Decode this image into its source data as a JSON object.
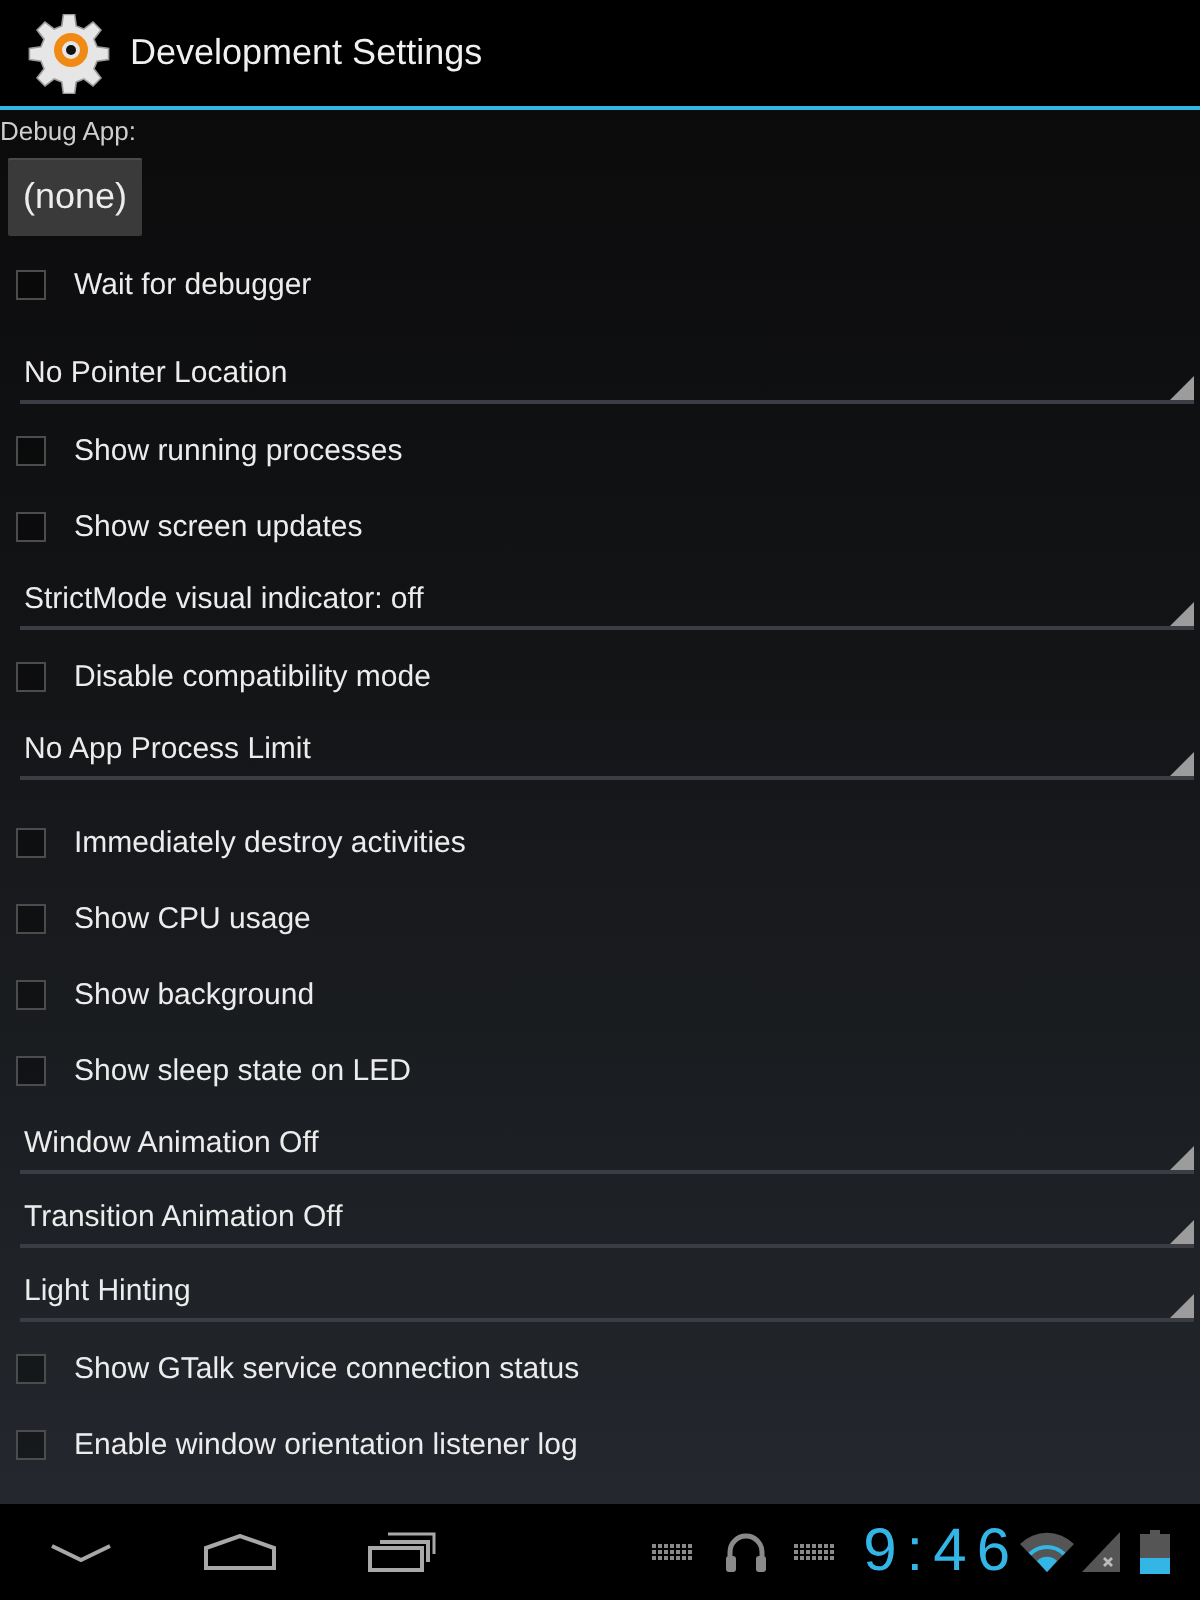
{
  "title_bar": {
    "title": "Development Settings"
  },
  "groups": [
    {
      "items": [
        {
          "kind": "label",
          "text": "Debug App:"
        },
        {
          "kind": "button",
          "label": "(none)"
        },
        {
          "kind": "checkbox",
          "label": "Wait for debugger",
          "checked": false
        }
      ]
    },
    {
      "items": [
        {
          "kind": "spinner",
          "value": "No Pointer Location"
        },
        {
          "kind": "checkbox",
          "label": "Show running processes",
          "checked": false
        },
        {
          "kind": "checkbox",
          "label": "Show screen updates",
          "checked": false
        },
        {
          "kind": "spinner",
          "value": "StrictMode visual indicator: off"
        },
        {
          "kind": "checkbox",
          "label": "Disable compatibility mode",
          "checked": false
        },
        {
          "kind": "spinner",
          "value": "No App Process Limit"
        }
      ]
    },
    {
      "items": [
        {
          "kind": "checkbox",
          "label": "Immediately destroy activities",
          "checked": false
        },
        {
          "kind": "checkbox",
          "label": "Show CPU usage",
          "checked": false
        },
        {
          "kind": "checkbox",
          "label": "Show background",
          "checked": false
        },
        {
          "kind": "checkbox",
          "label": "Show sleep state on LED",
          "checked": false
        },
        {
          "kind": "spinner",
          "value": "Window Animation Off"
        },
        {
          "kind": "spinner",
          "value": "Transition Animation Off"
        },
        {
          "kind": "spinner",
          "value": "Light Hinting"
        },
        {
          "kind": "checkbox",
          "label": "Show GTalk service connection status",
          "checked": false
        },
        {
          "kind": "checkbox",
          "label": "Enable window orientation listener log",
          "checked": false
        }
      ]
    }
  ],
  "nav_bar": {
    "clock": "9:46"
  }
}
